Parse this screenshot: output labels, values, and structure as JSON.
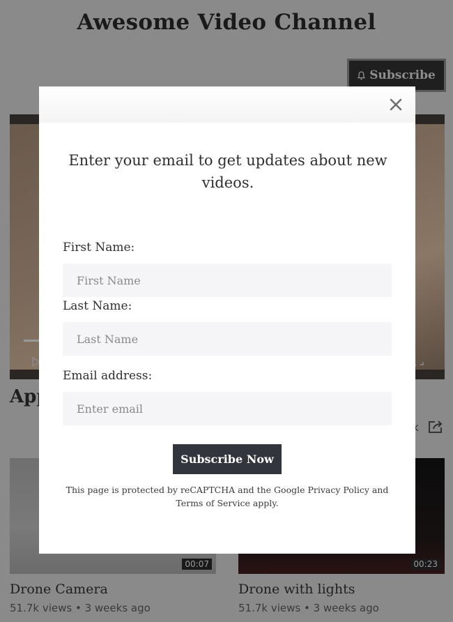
{
  "channel": {
    "title": "Awesome Video Channel",
    "subscribe_label": "Subscribe"
  },
  "featured": {
    "title_fragment": "App",
    "x_fragment": "k"
  },
  "videos": [
    {
      "title": "Drone Camera",
      "meta": "51.7k views • 3 weeks ago",
      "duration": "00:07"
    },
    {
      "title": "Drone with lights",
      "meta": "51.7k views • 3 weeks ago",
      "duration": "00:23"
    }
  ],
  "modal": {
    "heading": "Enter your email to get updates about new videos.",
    "first_name": {
      "label": "First Name:",
      "placeholder": "First Name"
    },
    "last_name": {
      "label": "Last Name:",
      "placeholder": "Last Name"
    },
    "email": {
      "label": "Email address:",
      "placeholder": "Enter email"
    },
    "submit_label": "Subscribe Now",
    "legal": "This page is protected by reCAPTCHA and the Google Privacy Policy and Terms of Service apply."
  },
  "icons": {
    "close": "close-icon",
    "bell": "bell-icon",
    "share": "share-icon"
  },
  "colors": {
    "overlay": "#8a8a8a",
    "button_dark": "#32363c",
    "input_bg": "#f5f5f7"
  }
}
